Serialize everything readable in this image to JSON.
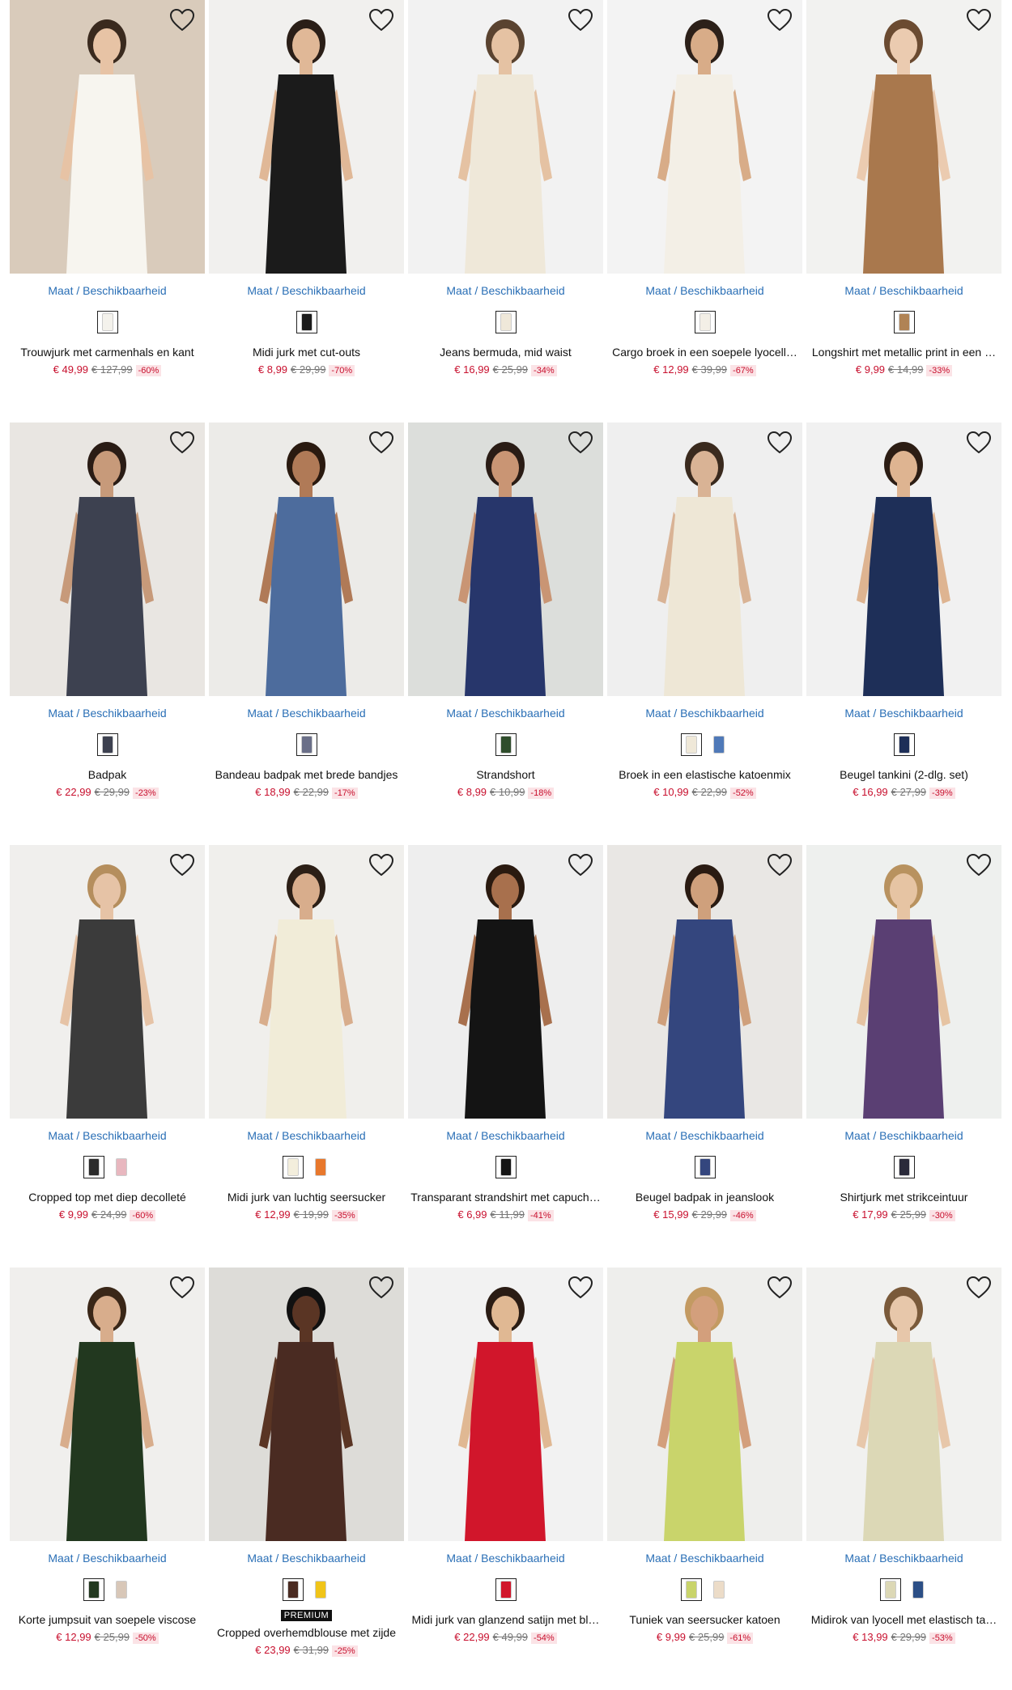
{
  "size_label": "Maat / Beschikbaarheid",
  "products": [
    {
      "name": "Trouwjurk met carmenhals en kant",
      "price": "€ 49,99",
      "was": "€ 127,99",
      "discount": "-60%",
      "bg": "#d9cbbb",
      "garment": "#f7f5ef",
      "skin": "#e7c3a5",
      "hair": "#3a2a1e",
      "swatches": [
        {
          "color": "#f4f2ec",
          "selected": true
        }
      ]
    },
    {
      "name": "Midi jurk met cut-outs",
      "price": "€ 8,99",
      "was": "€ 29,99",
      "discount": "-70%",
      "bg": "#f1f0ee",
      "garment": "#1b1b1b",
      "skin": "#e0b897",
      "hair": "#2a1e17",
      "swatches": [
        {
          "color": "#1b1b1b",
          "selected": true
        }
      ]
    },
    {
      "name": "Jeans bermuda, mid waist",
      "price": "€ 16,99",
      "was": "€ 25,99",
      "discount": "-34%",
      "bg": "#f2f2f2",
      "garment": "#efe8d9",
      "skin": "#e5c2a3",
      "hair": "#5a4330",
      "swatches": [
        {
          "color": "#efe8d9",
          "selected": true
        }
      ]
    },
    {
      "name": "Cargo broek in een soepele lyocell…",
      "price": "€ 12,99",
      "was": "€ 39,99",
      "discount": "-67%",
      "bg": "#f3f3f3",
      "garment": "#f3efe6",
      "skin": "#d8ac88",
      "hair": "#2c2019",
      "swatches": [
        {
          "color": "#f3efe6",
          "selected": true
        }
      ]
    },
    {
      "name": "Longshirt met metallic print in een …",
      "price": "€ 9,99",
      "was": "€ 14,99",
      "discount": "-33%",
      "bg": "#f2f2f0",
      "garment": "#a9784d",
      "skin": "#ebcbb0",
      "hair": "#6b4b31",
      "swatches": [
        {
          "color": "#b08355",
          "selected": true
        }
      ]
    },
    {
      "name": "Badpak",
      "price": "€ 22,99",
      "was": "€ 29,99",
      "discount": "-23%",
      "bg": "#e9e6e2",
      "garment": "#3d4150",
      "skin": "#c79a7a",
      "hair": "#2a1c15",
      "swatches": [
        {
          "color": "#3d4150",
          "selected": true
        }
      ]
    },
    {
      "name": "Bandeau badpak met brede bandjes",
      "price": "€ 18,99",
      "was": "€ 22,99",
      "discount": "-17%",
      "bg": "#ecebe8",
      "garment": "#4d6c9d",
      "skin": "#b07a57",
      "hair": "#2a1a10",
      "swatches": [
        {
          "color": "#6a6f88",
          "selected": true
        }
      ]
    },
    {
      "name": "Strandshort",
      "price": "€ 8,99",
      "was": "€ 10,99",
      "discount": "-18%",
      "bg": "#dcdedb",
      "garment": "#27366b",
      "skin": "#c99574",
      "hair": "#2a1c15",
      "swatches": [
        {
          "color": "#2f4d2c",
          "selected": true
        }
      ]
    },
    {
      "name": "Broek in een elastische katoenmix",
      "price": "€ 10,99",
      "was": "€ 22,99",
      "discount": "-52%",
      "bg": "#efefef",
      "garment": "#eee7d6",
      "skin": "#d9b395",
      "hair": "#3a2a1e",
      "swatches": [
        {
          "color": "#efe8d8",
          "selected": true
        },
        {
          "color": "#4f79b8",
          "selected": false
        }
      ]
    },
    {
      "name": "Beugel tankini (2-dlg. set)",
      "price": "€ 16,99",
      "was": "€ 27,99",
      "discount": "-39%",
      "bg": "#f1f1f1",
      "garment": "#1e2f58",
      "skin": "#deb491",
      "hair": "#2c1d14",
      "swatches": [
        {
          "color": "#1e2f58",
          "selected": true
        }
      ]
    },
    {
      "name": "Cropped top met diep decolleté",
      "price": "€ 9,99",
      "was": "€ 24,99",
      "discount": "-60%",
      "bg": "#f0efed",
      "garment": "#3b3b3b",
      "skin": "#e6c3a6",
      "hair": "#b58e5d",
      "swatches": [
        {
          "color": "#2b2b2b",
          "selected": true
        },
        {
          "color": "#e8b7bf",
          "selected": false
        }
      ]
    },
    {
      "name": "Midi jurk van luchtig seersucker",
      "price": "€ 12,99",
      "was": "€ 19,99",
      "discount": "-35%",
      "bg": "#f0efec",
      "garment": "#f1ecd8",
      "skin": "#d8ad8c",
      "hair": "#2c1f16",
      "swatches": [
        {
          "color": "#f3eedc",
          "selected": true
        },
        {
          "color": "#e8782c",
          "selected": false
        }
      ]
    },
    {
      "name": "Transparant strandshirt met capuch…",
      "price": "€ 6,99",
      "was": "€ 11,99",
      "discount": "-41%",
      "bg": "#eeeeee",
      "garment": "#141414",
      "skin": "#a8704d",
      "hair": "#2a1a10",
      "swatches": [
        {
          "color": "#141414",
          "selected": true
        }
      ]
    },
    {
      "name": "Beugel badpak in jeanslook",
      "price": "€ 15,99",
      "was": "€ 29,99",
      "discount": "-46%",
      "bg": "#e9e7e4",
      "garment": "#34467e",
      "skin": "#cfa07c",
      "hair": "#2a1b12",
      "swatches": [
        {
          "color": "#34467e",
          "selected": true
        }
      ]
    },
    {
      "name": "Shirtjurk met strikceintuur",
      "price": "€ 17,99",
      "was": "€ 25,99",
      "discount": "-30%",
      "bg": "#eef0ee",
      "garment": "#5a3f73",
      "skin": "#e6c4a3",
      "hair": "#b8925f",
      "swatches": [
        {
          "color": "#2a2a3a",
          "selected": true
        }
      ]
    },
    {
      "name": "Korte jumpsuit van soepele viscose",
      "price": "€ 12,99",
      "was": "€ 25,99",
      "discount": "-50%",
      "bg": "#f0efed",
      "garment": "#22381f",
      "skin": "#d8ad8c",
      "hair": "#3a2718",
      "swatches": [
        {
          "color": "#22381f",
          "selected": true
        },
        {
          "color": "#d8c7b8",
          "selected": false
        }
      ]
    },
    {
      "name": "Cropped overhemdblouse met zijde",
      "price": "€ 23,99",
      "was": "€ 31,99",
      "discount": "-25%",
      "badge": "PREMIUM",
      "bg": "#dddcd8",
      "garment": "#4a2b22",
      "skin": "#5a3524",
      "hair": "#111111",
      "swatches": [
        {
          "color": "#4a2b22",
          "selected": true
        },
        {
          "color": "#f0c419",
          "selected": false
        }
      ]
    },
    {
      "name": "Midi jurk van glanzend satijn met bl…",
      "price": "€ 22,99",
      "was": "€ 49,99",
      "discount": "-54%",
      "bg": "#f2f2f2",
      "garment": "#d1162b",
      "skin": "#e0b893",
      "hair": "#2a1c14",
      "swatches": [
        {
          "color": "#d1162b",
          "selected": true
        }
      ]
    },
    {
      "name": "Tuniek van seersucker katoen",
      "price": "€ 9,99",
      "was": "€ 25,99",
      "discount": "-61%",
      "bg": "#eeeeec",
      "garment": "#c9d46b",
      "skin": "#d39f7c",
      "hair": "#c39a62",
      "swatches": [
        {
          "color": "#c9d46b",
          "selected": true
        },
        {
          "color": "#ecdcc8",
          "selected": false
        }
      ]
    },
    {
      "name": "Midirok van lyocell met elastisch ta…",
      "price": "€ 13,99",
      "was": "€ 29,99",
      "discount": "-53%",
      "bg": "#f1f1ef",
      "garment": "#dcd8b6",
      "skin": "#e7c7aa",
      "hair": "#7a5a3a",
      "swatches": [
        {
          "color": "#dcd8b6",
          "selected": true
        },
        {
          "color": "#2c4f86",
          "selected": false
        }
      ]
    }
  ]
}
